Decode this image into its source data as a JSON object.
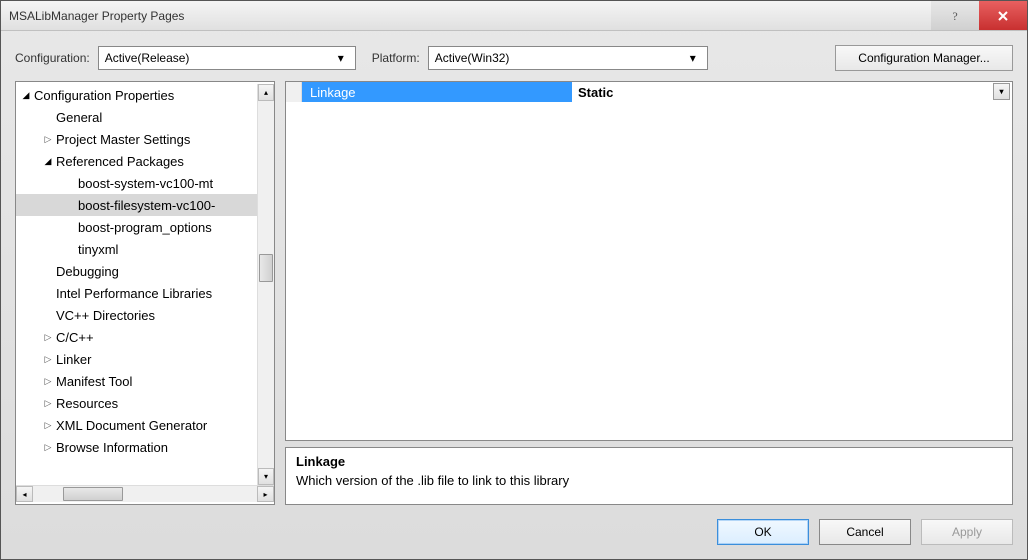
{
  "title": "MSALibManager Property Pages",
  "configBar": {
    "configurationLabel": "Configuration:",
    "configurationValue": "Active(Release)",
    "platformLabel": "Platform:",
    "platformValue": "Active(Win32)",
    "configManagerBtn": "Configuration Manager..."
  },
  "tree": {
    "root": "Configuration Properties",
    "items": [
      "General",
      "Project Master Settings",
      "Referenced Packages",
      "boost-system-vc100-mt",
      "boost-filesystem-vc100-",
      "boost-program_options",
      "tinyxml",
      "Debugging",
      "Intel Performance Libraries",
      "VC++ Directories",
      "C/C++",
      "Linker",
      "Manifest Tool",
      "Resources",
      "XML Document Generator",
      "Browse Information"
    ]
  },
  "property": {
    "name": "Linkage",
    "value": "Static"
  },
  "description": {
    "title": "Linkage",
    "text": "Which version of the .lib file to link to this library"
  },
  "buttons": {
    "ok": "OK",
    "cancel": "Cancel",
    "apply": "Apply"
  }
}
